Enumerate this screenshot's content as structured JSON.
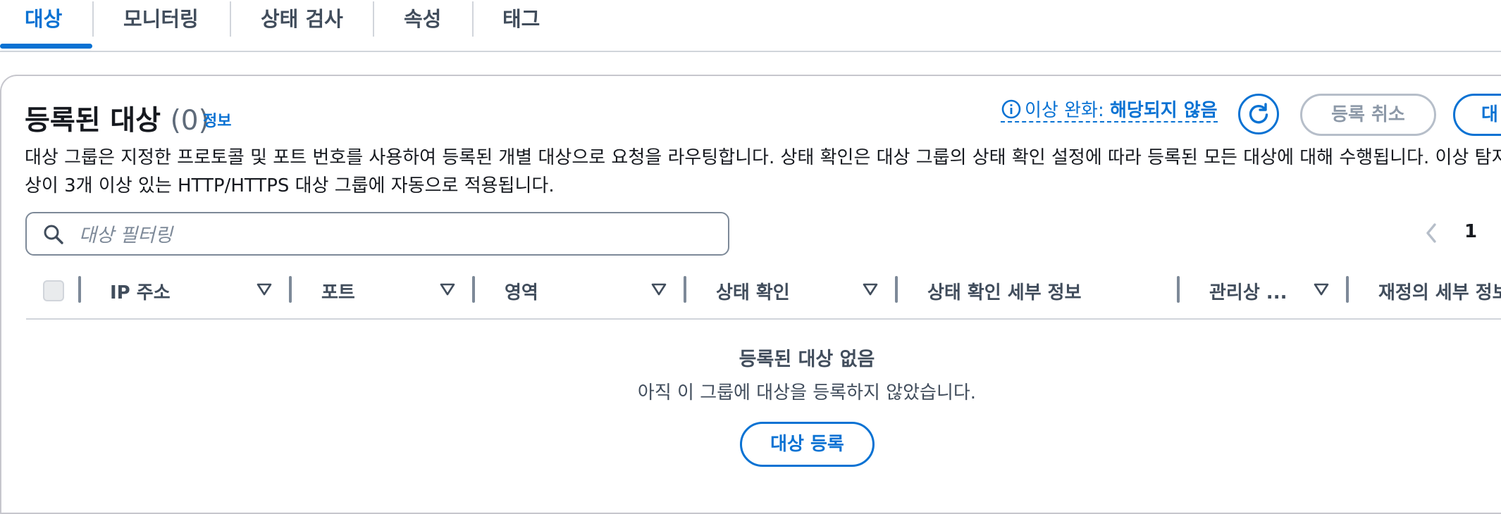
{
  "tabs": [
    {
      "label": "대상",
      "active": true
    },
    {
      "label": "모니터링",
      "active": false
    },
    {
      "label": "상태 검사",
      "active": false
    },
    {
      "label": "속성",
      "active": false
    },
    {
      "label": "태그",
      "active": false
    }
  ],
  "header": {
    "title": "등록된 대상",
    "count": "(0)",
    "info_link": "정보",
    "anomaly_label": "이상 완화:",
    "anomaly_value": "해당되지 않음",
    "deregister_label": "등록 취소",
    "register_label": "대"
  },
  "description": {
    "line1": "대상 그룹은 지정한 프로토콜 및 포트 번호를 사용하여 등록된 개별 대상으로 요청을 라우팅합니다. 상태 확인은 대상 그룹의 상태 확인 설정에 따라 등록된 모든 대상에 대해 수행됩니다. 이상 탐지",
    "line2": "상이 3개 이상 있는 HTTP/HTTPS 대상 그룹에 자동으로 적용됩니다."
  },
  "filter": {
    "placeholder": "대상 필터링",
    "value": ""
  },
  "pagination": {
    "current_page": "1"
  },
  "table": {
    "columns": [
      "IP 주소",
      "포트",
      "영역",
      "상태 확인",
      "상태 확인 세부 정보",
      "관리상 ...",
      "재정의 세부 정보"
    ]
  },
  "empty_state": {
    "title": "등록된 대상 없음",
    "description": "아직 이 그룹에 대상을 등록하지 않았습니다.",
    "button": "대상 등록"
  },
  "colors": {
    "accent": "#0972d3",
    "text": "#16191f",
    "muted": "#414d5c",
    "border": "#d1d5db"
  }
}
